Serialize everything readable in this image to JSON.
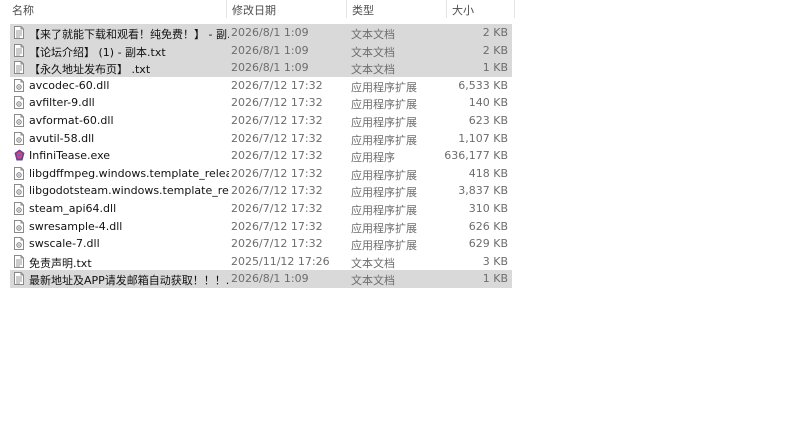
{
  "columns": {
    "name": "名称",
    "date": "修改日期",
    "type": "类型",
    "size": "大小"
  },
  "files": [
    {
      "name": "【来了就能下载和观看！纯免费！】 - 副...",
      "date": "2026/8/1 1:09",
      "type": "文本文档",
      "size": "2 KB",
      "icon": "text-file-icon",
      "selected": true
    },
    {
      "name": "【论坛介绍】 (1) - 副本.txt",
      "date": "2026/8/1 1:09",
      "type": "文本文档",
      "size": "2 KB",
      "icon": "text-file-icon",
      "selected": true
    },
    {
      "name": "【永久地址发布页】 .txt",
      "date": "2026/8/1 1:09",
      "type": "文本文档",
      "size": "1 KB",
      "icon": "text-file-icon",
      "selected": true
    },
    {
      "name": "avcodec-60.dll",
      "date": "2026/7/12 17:32",
      "type": "应用程序扩展",
      "size": "6,533 KB",
      "icon": "dll-file-icon",
      "selected": false
    },
    {
      "name": "avfilter-9.dll",
      "date": "2026/7/12 17:32",
      "type": "应用程序扩展",
      "size": "140 KB",
      "icon": "dll-file-icon",
      "selected": false
    },
    {
      "name": "avformat-60.dll",
      "date": "2026/7/12 17:32",
      "type": "应用程序扩展",
      "size": "623 KB",
      "icon": "dll-file-icon",
      "selected": false
    },
    {
      "name": "avutil-58.dll",
      "date": "2026/7/12 17:32",
      "type": "应用程序扩展",
      "size": "1,107 KB",
      "icon": "dll-file-icon",
      "selected": false
    },
    {
      "name": "InfiniTease.exe",
      "date": "2026/7/12 17:32",
      "type": "应用程序",
      "size": "636,177 KB",
      "icon": "exe-app-icon",
      "selected": false
    },
    {
      "name": "libgdffmpeg.windows.template_relea...",
      "date": "2026/7/12 17:32",
      "type": "应用程序扩展",
      "size": "418 KB",
      "icon": "dll-file-icon",
      "selected": false
    },
    {
      "name": "libgodotsteam.windows.template_rel...",
      "date": "2026/7/12 17:32",
      "type": "应用程序扩展",
      "size": "3,837 KB",
      "icon": "dll-file-icon",
      "selected": false
    },
    {
      "name": "steam_api64.dll",
      "date": "2026/7/12 17:32",
      "type": "应用程序扩展",
      "size": "310 KB",
      "icon": "dll-file-icon",
      "selected": false
    },
    {
      "name": "swresample-4.dll",
      "date": "2026/7/12 17:32",
      "type": "应用程序扩展",
      "size": "626 KB",
      "icon": "dll-file-icon",
      "selected": false
    },
    {
      "name": "swscale-7.dll",
      "date": "2026/7/12 17:32",
      "type": "应用程序扩展",
      "size": "629 KB",
      "icon": "dll-file-icon",
      "selected": false
    },
    {
      "name": "免责声明.txt",
      "date": "2025/11/12 17:26",
      "type": "文本文档",
      "size": "3 KB",
      "icon": "text-file-icon",
      "selected": false
    },
    {
      "name": "最新地址及APP请发邮箱自动获取！！！...",
      "date": "2026/8/1 1:09",
      "type": "文本文档",
      "size": "1 KB",
      "icon": "text-file-icon",
      "selected": true
    }
  ],
  "colors": {
    "selection": "#d9d9d9",
    "secondary_text": "#6d6d6d",
    "header_text": "#4d4d4d"
  }
}
